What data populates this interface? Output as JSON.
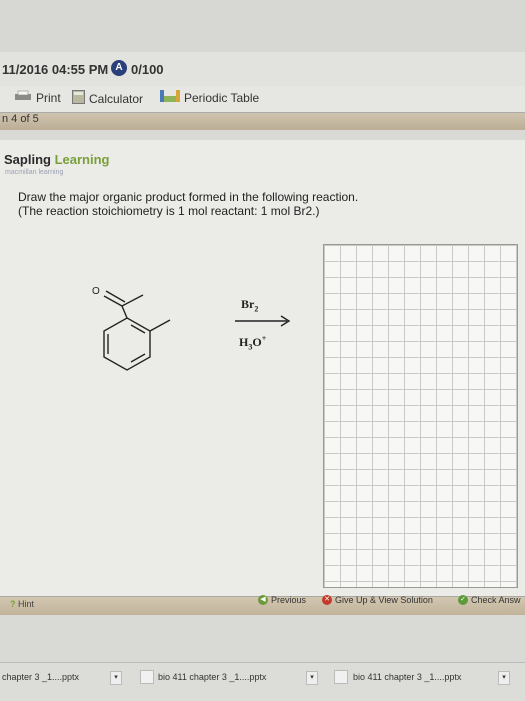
{
  "header": {
    "time": "11/2016 04:55 PM",
    "score_badge": "A",
    "score": "0/100"
  },
  "toolbar": {
    "print": "Print",
    "calculator": "Calculator",
    "periodic_table": "Periodic Table"
  },
  "question": {
    "progress": "n 4 of 5",
    "brand_main": "Sapling",
    "brand_learn": "Learning",
    "brand_sub": "macmillan learning",
    "prompt_line1": "Draw the major organic product formed in the following reaction.",
    "prompt_line2": "(The reaction stoichiometry is 1 mol reactant: 1 mol Br2.)"
  },
  "reaction": {
    "reagent_top": "Br",
    "reagent_top_sub": "2",
    "reagent_bottom": "H",
    "reagent_bottom_sub": "3",
    "reagent_bottom_tail": "O",
    "reagent_bottom_sup": "+",
    "atom_o": "O"
  },
  "nav": {
    "hint": "Hint",
    "previous": "Previous",
    "give_up": "Give Up & View Solution",
    "check": "Check Answ"
  },
  "downloads": [
    {
      "name": "chapter 3 _1....pptx"
    },
    {
      "name": "bio 411 chapter 3 _1....pptx"
    },
    {
      "name": "bio 411 chapter 3 _1....pptx"
    }
  ],
  "colors": {
    "accent_green": "#7a9f3a",
    "badge_blue": "#2b3f7a"
  }
}
